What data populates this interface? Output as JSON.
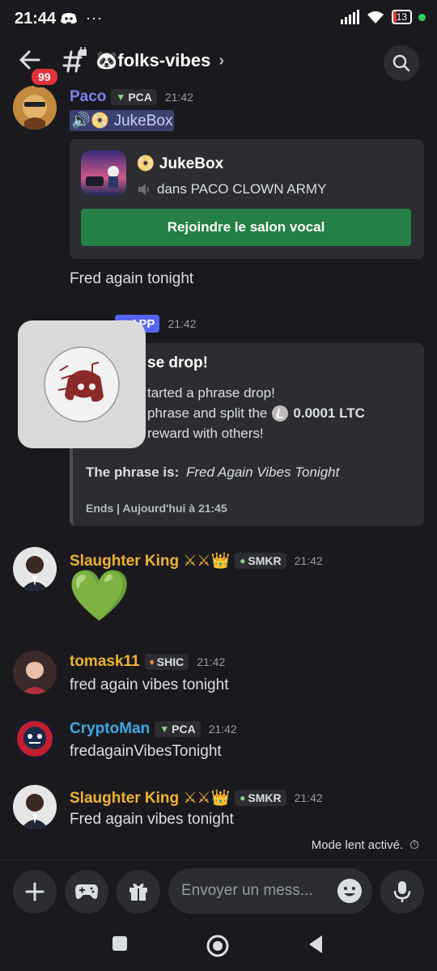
{
  "status_bar": {
    "time": "21:44",
    "battery": "13"
  },
  "header": {
    "channel_name": "🐼folks-vibes",
    "unread_badge": "99"
  },
  "messages": [
    {
      "username": "Paco",
      "tag": "PCA",
      "time": "21:42",
      "mention": "🔊📀 JukeBox",
      "voice_card": {
        "title": "📀 JukeBox",
        "subtitle": "dans PACO CLOWN ARMY",
        "join_label": "Rejoindre le salon vocal"
      },
      "text": "Fred again tonight"
    },
    {
      "app_tag": "APP",
      "time": "21:42",
      "embed": {
        "title": "se drop!",
        "line1": "tarted a phrase drop!",
        "line2_prefix": "phrase and split the",
        "amount": "0.0001 LTC",
        "line3": "reward with others!",
        "phrase_label": "The phrase is:",
        "phrase_value": "Fred Again Vibes Tonight",
        "footer": "Ends | Aujourd'hui à 21:45"
      }
    },
    {
      "username": "Slaughter King ⚔⚔👑",
      "tag": "SMKR",
      "time": "21:42",
      "text": "💚"
    },
    {
      "username": "tomask11",
      "tag": "SHIC",
      "time": "21:42",
      "text": "fred again vibes tonight"
    },
    {
      "username": "CryptoMan",
      "tag": "PCA",
      "time": "21:42",
      "text": "fredagainVibesTonight"
    },
    {
      "username": "Slaughter King ⚔⚔👑",
      "tag": "SMKR",
      "time": "21:42",
      "text": "Fred again vibes tonight"
    }
  ],
  "slow_mode": "Mode lent activé.",
  "composer": {
    "placeholder": "Envoyer un mess..."
  },
  "colors": {
    "background": "#1a1a1e",
    "card": "#2b2d31",
    "paco": "#7b7ff0",
    "gold": "#f0b232",
    "cryptoman": "#3ea8e6",
    "join": "#248046",
    "app": "#5865f2"
  },
  "icons": [
    "back-arrow-icon",
    "channel-hash-lock-icon",
    "chevron-right-icon",
    "search-icon",
    "plus-icon",
    "gamepad-icon",
    "gift-icon",
    "emoji-icon",
    "microphone-icon",
    "timer-icon",
    "speaker-icon",
    "litecoin-icon",
    "stop-square-icon",
    "home-circle-icon",
    "back-triangle-icon"
  ]
}
